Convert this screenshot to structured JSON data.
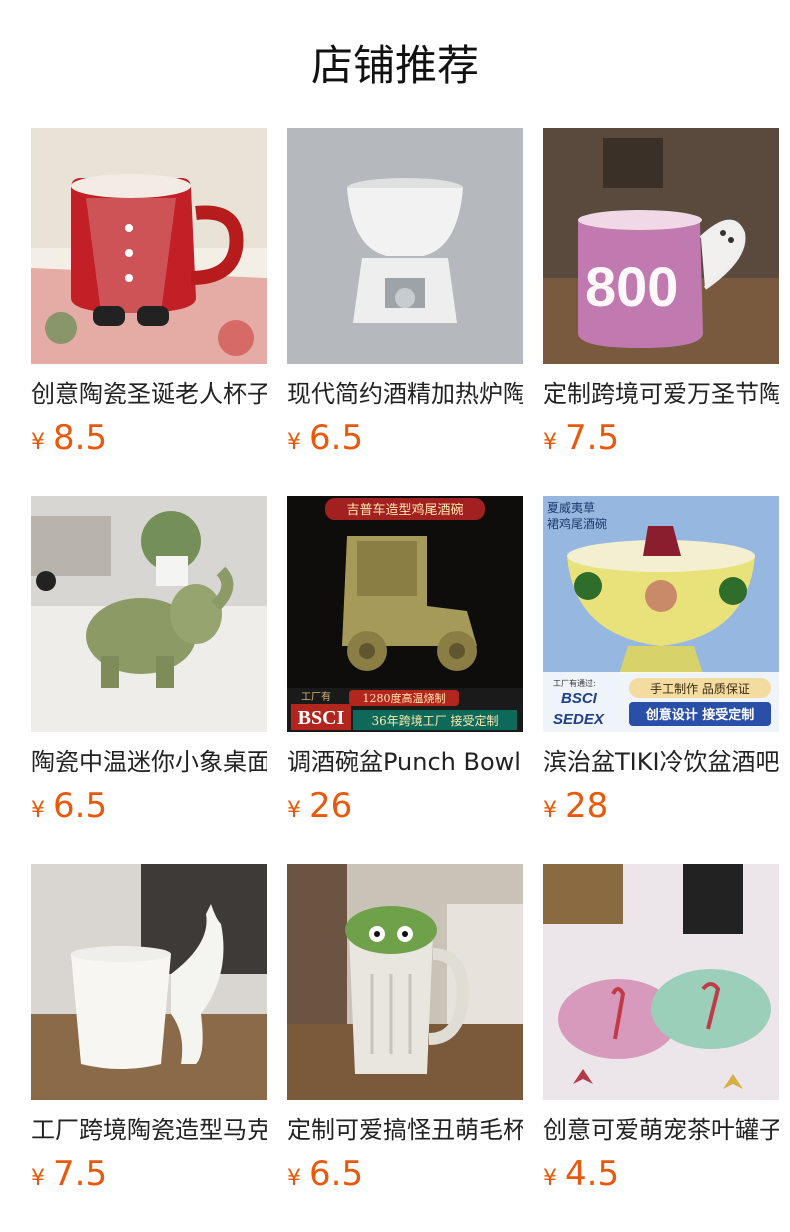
{
  "section_title": "店铺推荐",
  "products": [
    {
      "name": "创意陶瓷圣诞老人杯子",
      "currency": "¥",
      "price": "8.5"
    },
    {
      "name": "现代简约酒精加热炉陶瓷",
      "currency": "¥",
      "price": "6.5"
    },
    {
      "name": "定制跨境可爱万圣节陶瓷",
      "currency": "¥",
      "price": "7.5"
    },
    {
      "name": "陶瓷中温迷你小象桌面摆件",
      "currency": "¥",
      "price": "6.5"
    },
    {
      "name": "调酒碗盆Punch Bowl",
      "currency": "¥",
      "price": "26"
    },
    {
      "name": "滨治盆TIKI冷饮盆酒吧",
      "currency": "¥",
      "price": "28"
    },
    {
      "name": "工厂跨境陶瓷造型马克杯",
      "currency": "¥",
      "price": "7.5"
    },
    {
      "name": "定制可爱搞怪丑萌毛杯子",
      "currency": "¥",
      "price": "6.5"
    },
    {
      "name": "创意可爱萌宠茶叶罐子",
      "currency": "¥",
      "price": "4.5"
    }
  ],
  "image_text": {
    "jeep_banner_top": "吉普车造型鸡尾酒碗",
    "jeep_factory": "工厂有",
    "jeep_temp": "1280度高温烧制",
    "jeep_bsci": "BSCI",
    "jeep_bottom": "36年跨境工厂  接受定制",
    "tiki_top1": "夏威夷草",
    "tiki_top2": "裙鸡尾酒碗",
    "tiki_cert": "工厂有通过:",
    "tiki_bsci": "BSCI",
    "tiki_sedex": "SEDEX",
    "tiki_tag1": "手工制作 品质保证",
    "tiki_tag2": "创意设计 接受定制"
  }
}
